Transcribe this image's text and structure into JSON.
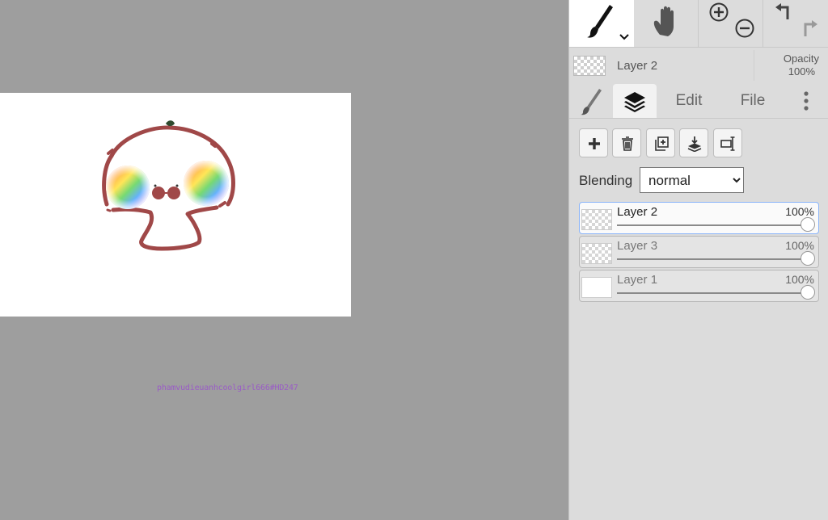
{
  "canvas": {
    "signature": "phamvudieuanhcoolgirl666#HD247"
  },
  "toolbar": {
    "brush_icon": "brush-icon",
    "hand_icon": "hand-icon",
    "zoom_in_icon": "zoom-in-icon",
    "zoom_out_icon": "zoom-out-icon",
    "undo_icon": "undo-icon",
    "redo_icon": "redo-icon"
  },
  "current_layer": {
    "name": "Layer 2",
    "opacity_label": "Opacity",
    "opacity_value": "100%"
  },
  "tabs": {
    "edit": "Edit",
    "file": "File"
  },
  "blending": {
    "label": "Blending",
    "selected": "normal"
  },
  "layers": [
    {
      "name": "Layer 2",
      "opacity": "100%",
      "active": true
    },
    {
      "name": "Layer 3",
      "opacity": "100%",
      "active": false
    },
    {
      "name": "Layer 1",
      "opacity": "100%",
      "active": false
    }
  ],
  "colors": {
    "workspace_bg": "#9e9e9e",
    "panel_bg": "#dcdcdc",
    "active_layer_border": "#8ab4f8",
    "drawing_stroke": "#a04848",
    "signature_color": "#9a5cc6"
  }
}
